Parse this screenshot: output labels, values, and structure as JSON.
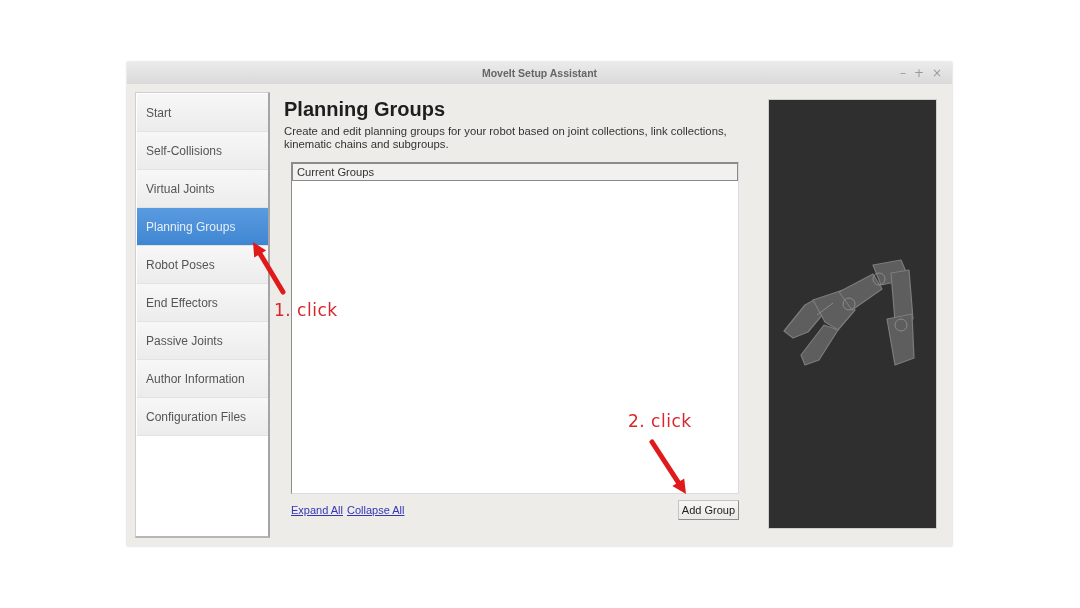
{
  "window": {
    "title": "MoveIt Setup Assistant",
    "controls": [
      "–",
      "+",
      "×"
    ]
  },
  "sidebar": {
    "items": [
      {
        "label": "Start",
        "selected": false
      },
      {
        "label": "Self-Collisions",
        "selected": false
      },
      {
        "label": "Virtual Joints",
        "selected": false
      },
      {
        "label": "Planning Groups",
        "selected": true
      },
      {
        "label": "Robot Poses",
        "selected": false
      },
      {
        "label": "End Effectors",
        "selected": false
      },
      {
        "label": "Passive Joints",
        "selected": false
      },
      {
        "label": "Author Information",
        "selected": false
      },
      {
        "label": "Configuration Files",
        "selected": false
      }
    ]
  },
  "page": {
    "title": "Planning Groups",
    "description": "Create and edit planning groups for your robot based on joint collections, link collections, kinematic chains and subgroups."
  },
  "tree": {
    "columns": [
      "Current Groups"
    ]
  },
  "links": [
    "Expand All",
    "Collapse All"
  ],
  "buttons": [
    "Add Group"
  ],
  "annotations": [
    {
      "text": "1. click"
    },
    {
      "text": "2. click"
    }
  ]
}
